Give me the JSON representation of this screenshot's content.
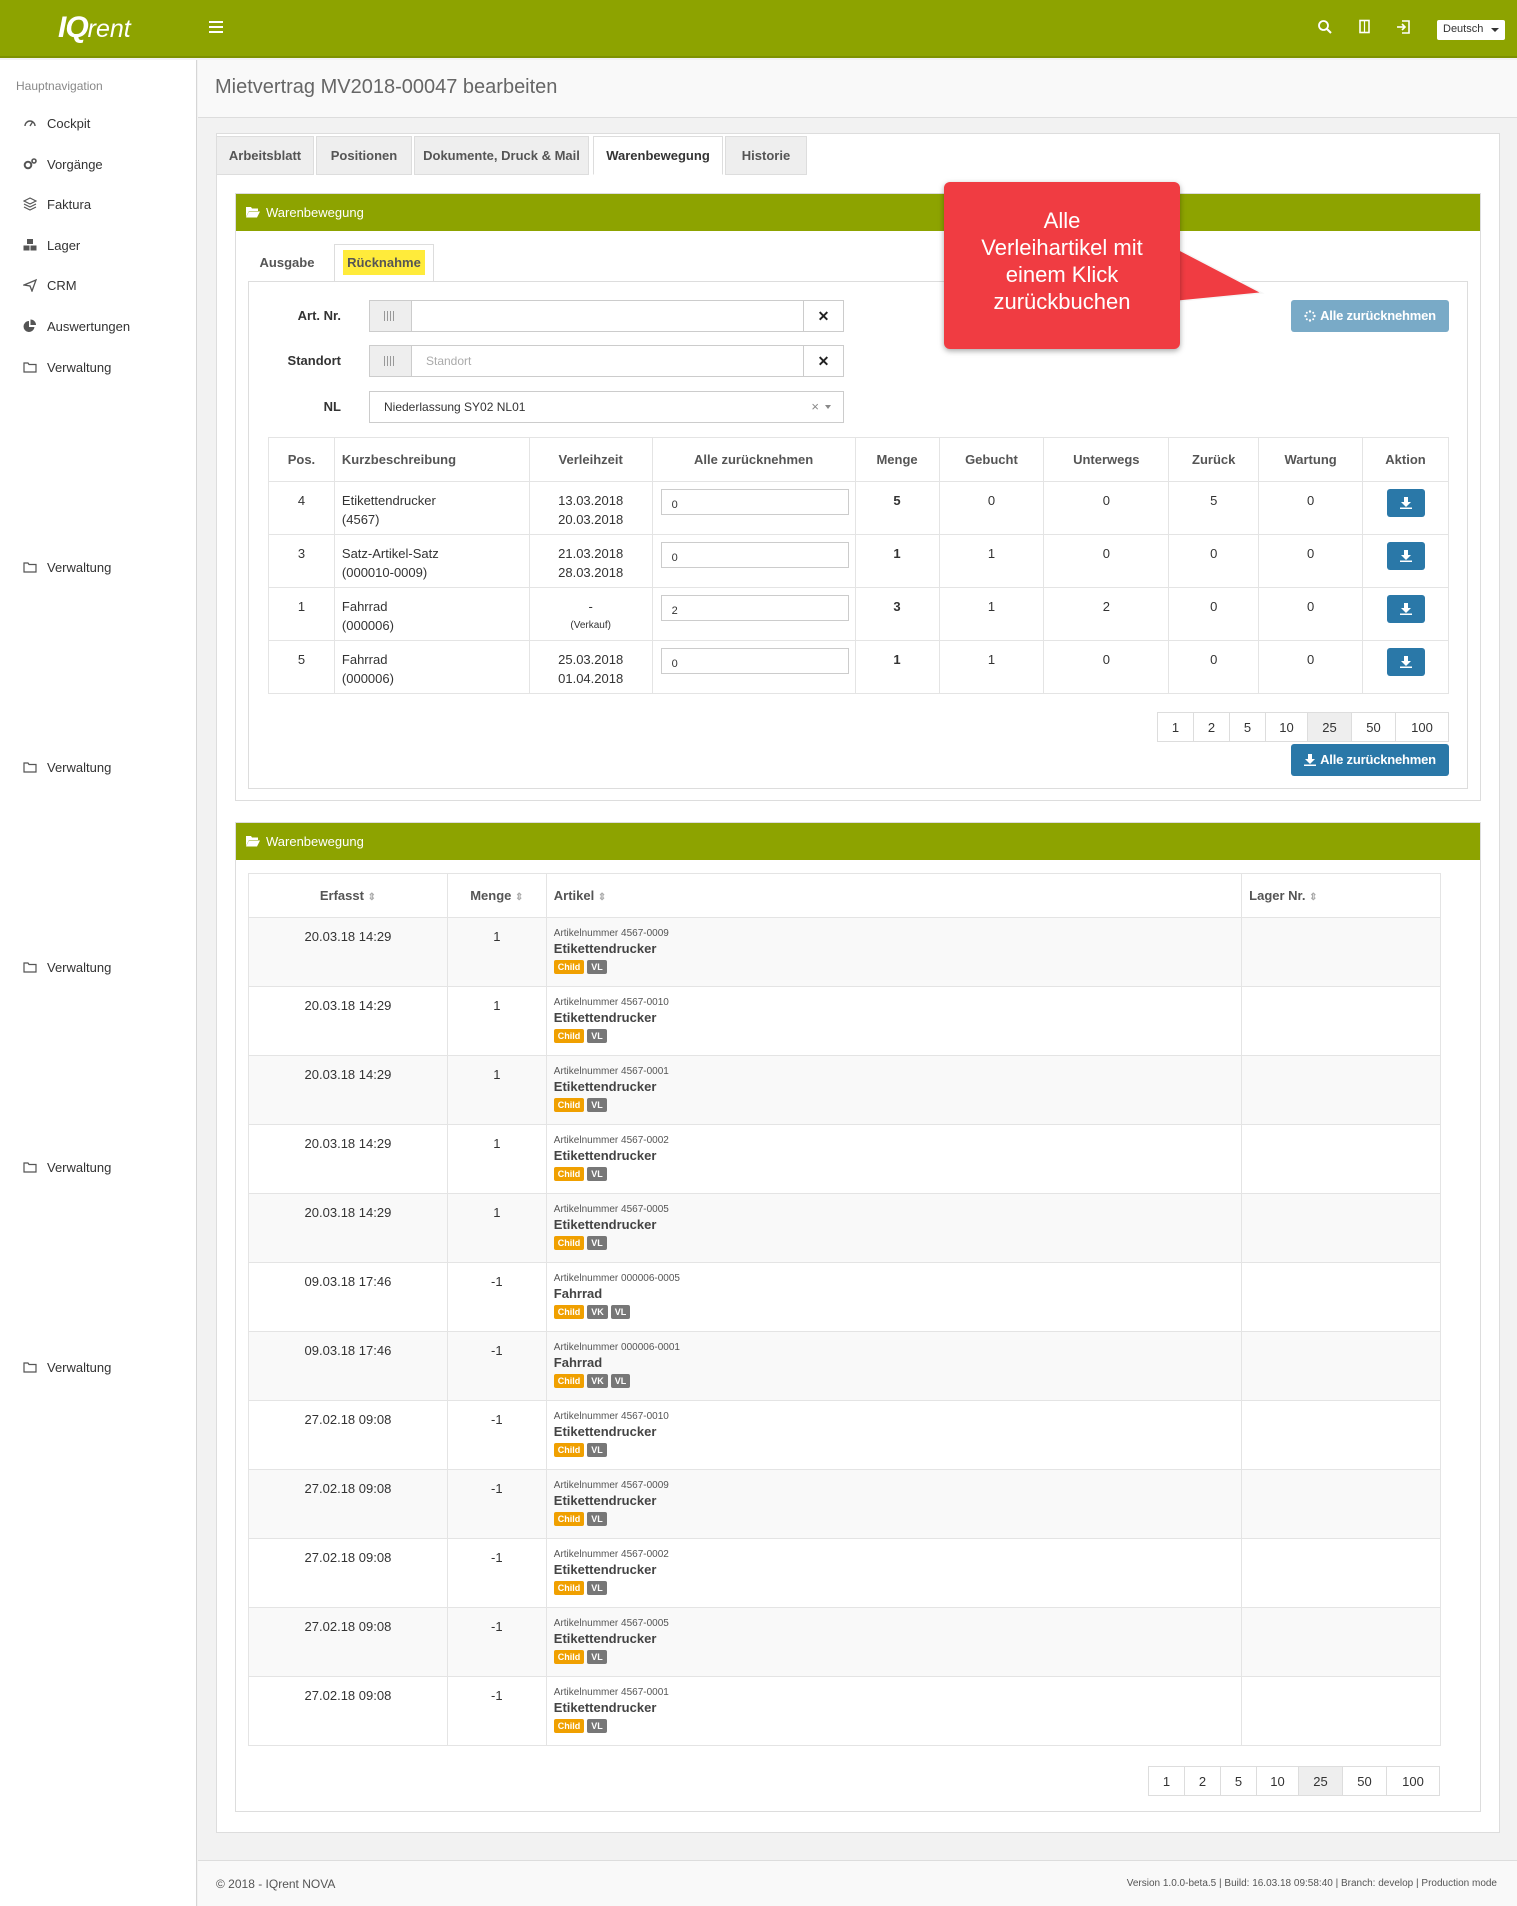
{
  "app": {
    "logo_main": "IQ",
    "logo_rest": "rent",
    "language": "Deutsch"
  },
  "sidebar": {
    "heading": "Hauptnavigation",
    "items": [
      {
        "label": "Cockpit",
        "icon": "dashboard-icon"
      },
      {
        "label": "Vorgänge",
        "icon": "cogs-icon"
      },
      {
        "label": "Faktura",
        "icon": "layers-icon"
      },
      {
        "label": "Lager",
        "icon": "cubes-icon"
      },
      {
        "label": "CRM",
        "icon": "send-icon"
      },
      {
        "label": "Auswertungen",
        "icon": "pie-chart-icon"
      },
      {
        "label": "Verwaltung",
        "icon": "folder-icon"
      },
      {
        "label": "Verwaltung",
        "icon": "folder-icon"
      },
      {
        "label": "Verwaltung",
        "icon": "folder-icon"
      },
      {
        "label": "Verwaltung",
        "icon": "folder-icon"
      },
      {
        "label": "Verwaltung",
        "icon": "folder-icon"
      },
      {
        "label": "Verwaltung",
        "icon": "folder-icon"
      }
    ]
  },
  "page": {
    "title": "Mietvertrag MV2018-00047 bearbeiten",
    "tabs": [
      "Arbeitsblatt",
      "Positionen",
      "Dokumente, Druck & Mail",
      "Warenbewegung",
      "Historie"
    ],
    "active_tab": "Warenbewegung"
  },
  "panel1": {
    "title": "Warenbewegung",
    "subtabs": [
      "Ausgabe",
      "Rücknahme"
    ],
    "form": {
      "art_label": "Art. Nr.",
      "art_value": "",
      "standort_label": "Standort",
      "standort_placeholder": "Standort",
      "nl_label": "NL",
      "nl_value": "Niederlassung SY02 NL01"
    },
    "top_button": "Alle zurücknehmen",
    "bottom_button": "Alle zurücknehmen",
    "table": {
      "headers": [
        "Pos.",
        "Kurzbeschreibung",
        "Verleihzeit",
        "Alle zurücknehmen",
        "Menge",
        "Gebucht",
        "Unterwegs",
        "Zurück",
        "Wartung",
        "Aktion"
      ],
      "rows": [
        {
          "pos": "4",
          "desc1": "Etikettendrucker",
          "desc2": "(4567)",
          "time1": "13.03.2018",
          "time2": "20.03.2018",
          "input": "0",
          "menge": "5",
          "gebucht": "0",
          "unterwegs": "0",
          "zurueck": "5",
          "wartung": "0"
        },
        {
          "pos": "3",
          "desc1": "Satz-Artikel-Satz",
          "desc2": "(000010-0009)",
          "time1": "21.03.2018",
          "time2": "28.03.2018",
          "input": "0",
          "menge": "1",
          "gebucht": "1",
          "unterwegs": "0",
          "zurueck": "0",
          "wartung": "0"
        },
        {
          "pos": "1",
          "desc1": "Fahrrad",
          "desc2": "(000006)",
          "time1": "-",
          "time2": "(Verkauf)",
          "input": "2",
          "menge": "3",
          "gebucht": "1",
          "unterwegs": "2",
          "zurueck": "0",
          "wartung": "0"
        },
        {
          "pos": "5",
          "desc1": "Fahrrad",
          "desc2": "(000006)",
          "time1": "25.03.2018",
          "time2": "01.04.2018",
          "input": "0",
          "menge": "1",
          "gebucht": "1",
          "unterwegs": "0",
          "zurueck": "0",
          "wartung": "0"
        }
      ]
    },
    "pager": [
      "1",
      "2",
      "5",
      "10",
      "25",
      "50",
      "100"
    ],
    "pager_active": "25"
  },
  "callout": {
    "line1": "Alle",
    "line2": "Verleihartikel mit",
    "line3": "einem Klick",
    "line4": "zurückbuchen"
  },
  "panel2": {
    "title": "Warenbewegung",
    "headers": [
      "Erfasst",
      "Menge",
      "Artikel",
      "Lager Nr."
    ],
    "rows": [
      {
        "date": "20.03.18 14:29",
        "qty": "1",
        "artnr": "Artikelnummer 4567-0009",
        "name": "Etikettendrucker",
        "badges": [
          "Child",
          "VL"
        ]
      },
      {
        "date": "20.03.18 14:29",
        "qty": "1",
        "artnr": "Artikelnummer 4567-0010",
        "name": "Etikettendrucker",
        "badges": [
          "Child",
          "VL"
        ]
      },
      {
        "date": "20.03.18 14:29",
        "qty": "1",
        "artnr": "Artikelnummer 4567-0001",
        "name": "Etikettendrucker",
        "badges": [
          "Child",
          "VL"
        ]
      },
      {
        "date": "20.03.18 14:29",
        "qty": "1",
        "artnr": "Artikelnummer 4567-0002",
        "name": "Etikettendrucker",
        "badges": [
          "Child",
          "VL"
        ]
      },
      {
        "date": "20.03.18 14:29",
        "qty": "1",
        "artnr": "Artikelnummer 4567-0005",
        "name": "Etikettendrucker",
        "badges": [
          "Child",
          "VL"
        ]
      },
      {
        "date": "09.03.18 17:46",
        "qty": "-1",
        "artnr": "Artikelnummer 000006-0005",
        "name": "Fahrrad",
        "badges": [
          "Child",
          "VK",
          "VL"
        ]
      },
      {
        "date": "09.03.18 17:46",
        "qty": "-1",
        "artnr": "Artikelnummer 000006-0001",
        "name": "Fahrrad",
        "badges": [
          "Child",
          "VK",
          "VL"
        ]
      },
      {
        "date": "27.02.18 09:08",
        "qty": "-1",
        "artnr": "Artikelnummer 4567-0010",
        "name": "Etikettendrucker",
        "badges": [
          "Child",
          "VL"
        ]
      },
      {
        "date": "27.02.18 09:08",
        "qty": "-1",
        "artnr": "Artikelnummer 4567-0009",
        "name": "Etikettendrucker",
        "badges": [
          "Child",
          "VL"
        ]
      },
      {
        "date": "27.02.18 09:08",
        "qty": "-1",
        "artnr": "Artikelnummer 4567-0002",
        "name": "Etikettendrucker",
        "badges": [
          "Child",
          "VL"
        ]
      },
      {
        "date": "27.02.18 09:08",
        "qty": "-1",
        "artnr": "Artikelnummer 4567-0005",
        "name": "Etikettendrucker",
        "badges": [
          "Child",
          "VL"
        ]
      },
      {
        "date": "27.02.18 09:08",
        "qty": "-1",
        "artnr": "Artikelnummer 4567-0001",
        "name": "Etikettendrucker",
        "badges": [
          "Child",
          "VL"
        ]
      }
    ],
    "pager": [
      "1",
      "2",
      "5",
      "10",
      "25",
      "50",
      "100"
    ],
    "pager_active": "25"
  },
  "footer": {
    "left": "© 2018 - IQrent NOVA",
    "right": "Version 1.0.0-beta.5 | Build: 16.03.18 09:58:40 | Branch: develop | Production mode"
  },
  "colors": {
    "brand": "#8da300",
    "primary_button": "#2a78a8",
    "callout": "#f03c42",
    "badge_child": "#f0a000",
    "badge_gray": "#777777",
    "highlight": "#ffeb3b"
  }
}
